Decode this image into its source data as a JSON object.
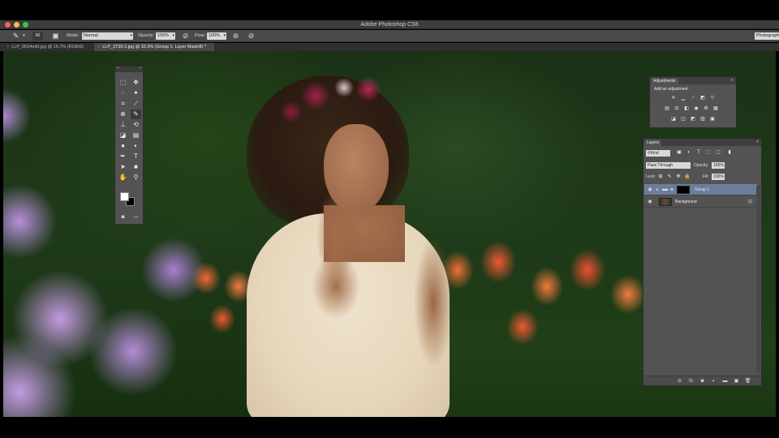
{
  "window": {
    "title": "Adobe Photoshop CS6",
    "traffic_colors": [
      "#fc615d",
      "#fdbc40",
      "#34c84a"
    ]
  },
  "options_bar": {
    "brush_size": "60",
    "mode_label": "Mode:",
    "mode_value": "Normal",
    "opacity_label": "Opacity:",
    "opacity_value": "100%",
    "flow_label": "Flow:",
    "flow_value": "100%",
    "workspace": "Photograph"
  },
  "tabs": [
    {
      "label": "LLP_0534edit.jpg @ 16.7% (RGB/8)",
      "active": false
    },
    {
      "label": "LLP_3739-2.jpg @ 33.3% (Group 1, Layer Mask/8) *",
      "active": true
    }
  ],
  "adjustments": {
    "title": "Adjustments",
    "subtitle": "Add an adjustment",
    "icons_row1": [
      "brightness-icon",
      "levels-icon",
      "curves-icon",
      "exposure-icon",
      "vibrance-icon"
    ],
    "icons_row2": [
      "hue-saturation-icon",
      "color-balance-icon",
      "black-white-icon",
      "photo-filter-icon",
      "channel-mixer-icon",
      "color-lookup-icon"
    ],
    "icons_row3": [
      "invert-icon",
      "posterize-icon",
      "threshold-icon",
      "gradient-map-icon",
      "selective-color-icon"
    ]
  },
  "layers": {
    "title": "Layers",
    "filter_kind": "Kind",
    "blend_mode": "Pass Through",
    "opacity_label": "Opacity:",
    "opacity_value": "100%",
    "lock_label": "Lock:",
    "fill_label": "Fill:",
    "fill_value": "100%",
    "items": [
      {
        "name": "Group 1",
        "selected": true
      },
      {
        "name": "Background",
        "selected": false
      }
    ]
  },
  "colors": {
    "foreground": "#ffffff",
    "background": "#000000",
    "selected_layer": "#6b7d9a"
  }
}
